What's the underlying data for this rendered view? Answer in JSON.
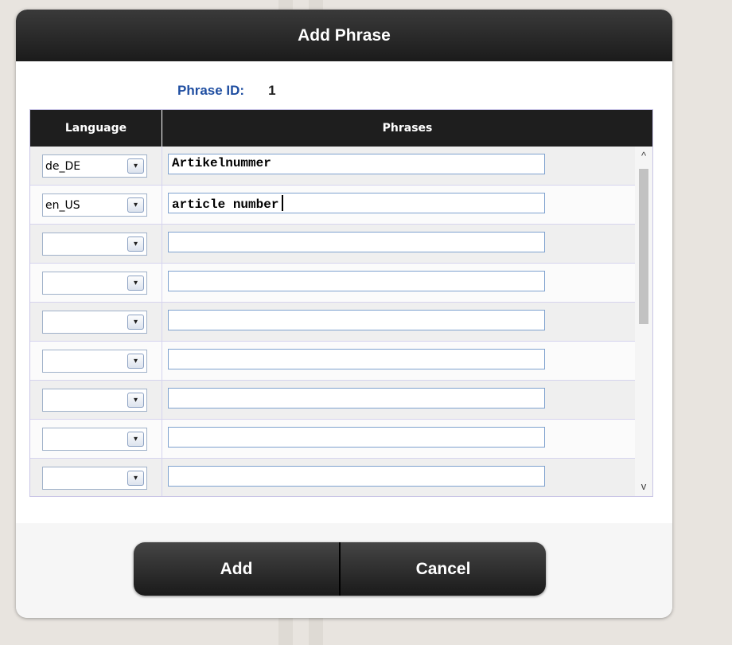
{
  "dialog": {
    "title": "Add Phrase",
    "phrase_id_label": "Phrase ID:",
    "phrase_id_value": "1"
  },
  "grid": {
    "columns": {
      "language": "Language",
      "phrases": "Phrases"
    },
    "rows": [
      {
        "language": "de_DE",
        "phrase": "Artikelnummer"
      },
      {
        "language": "en_US",
        "phrase": "article number"
      },
      {
        "language": "",
        "phrase": ""
      },
      {
        "language": "",
        "phrase": ""
      },
      {
        "language": "",
        "phrase": ""
      },
      {
        "language": "",
        "phrase": ""
      },
      {
        "language": "",
        "phrase": ""
      },
      {
        "language": "",
        "phrase": ""
      },
      {
        "language": "",
        "phrase": ""
      }
    ],
    "scroll_up_glyph": "^",
    "scroll_down_glyph": "v",
    "select_arrow_glyph": "▾"
  },
  "buttons": {
    "add": "Add",
    "cancel": "Cancel"
  },
  "colors": {
    "titlebar": "#1b1b1b",
    "phrase_id_label": "#1f4ea1",
    "input_border": "#7fa2cf"
  }
}
